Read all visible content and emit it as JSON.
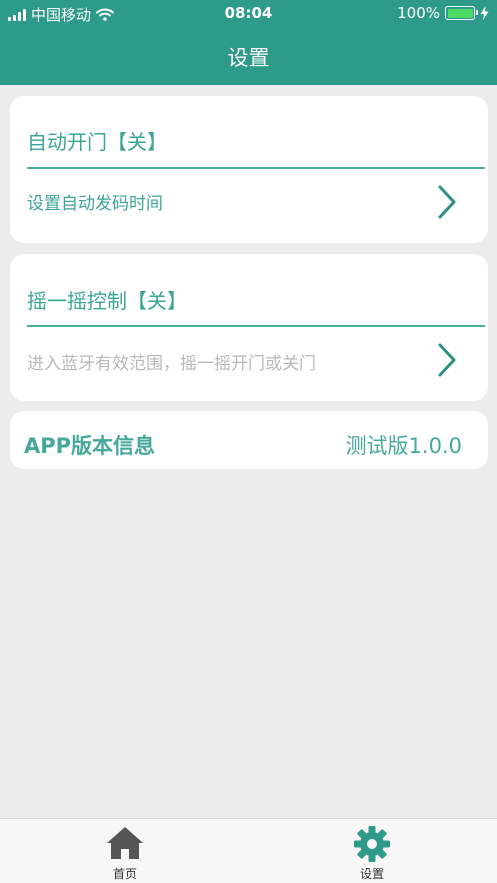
{
  "status_bar": {
    "carrier": "中国移动",
    "time": "08:04",
    "battery_percent": "100%",
    "battery_level": 1.0
  },
  "nav": {
    "title": "设置"
  },
  "cards": [
    {
      "title": "自动开门【关】",
      "subtitle": "设置自动发码时间"
    },
    {
      "title": "摇一摇控制【关】",
      "subtitle": "进入蓝牙有效范围，摇一摇开门或关门"
    }
  ],
  "version": {
    "label": "APP版本信息",
    "value": "测试版1.0.0"
  },
  "tabs": [
    {
      "label": "首页",
      "icon": "home-icon"
    },
    {
      "label": "设置",
      "icon": "gear-icon"
    }
  ],
  "colors": {
    "accent": "#2e9a8a",
    "text_accent": "#3aa597",
    "background": "#ececec",
    "active_tab_icon": "#2e9a8a",
    "inactive_tab_icon": "#555555"
  }
}
